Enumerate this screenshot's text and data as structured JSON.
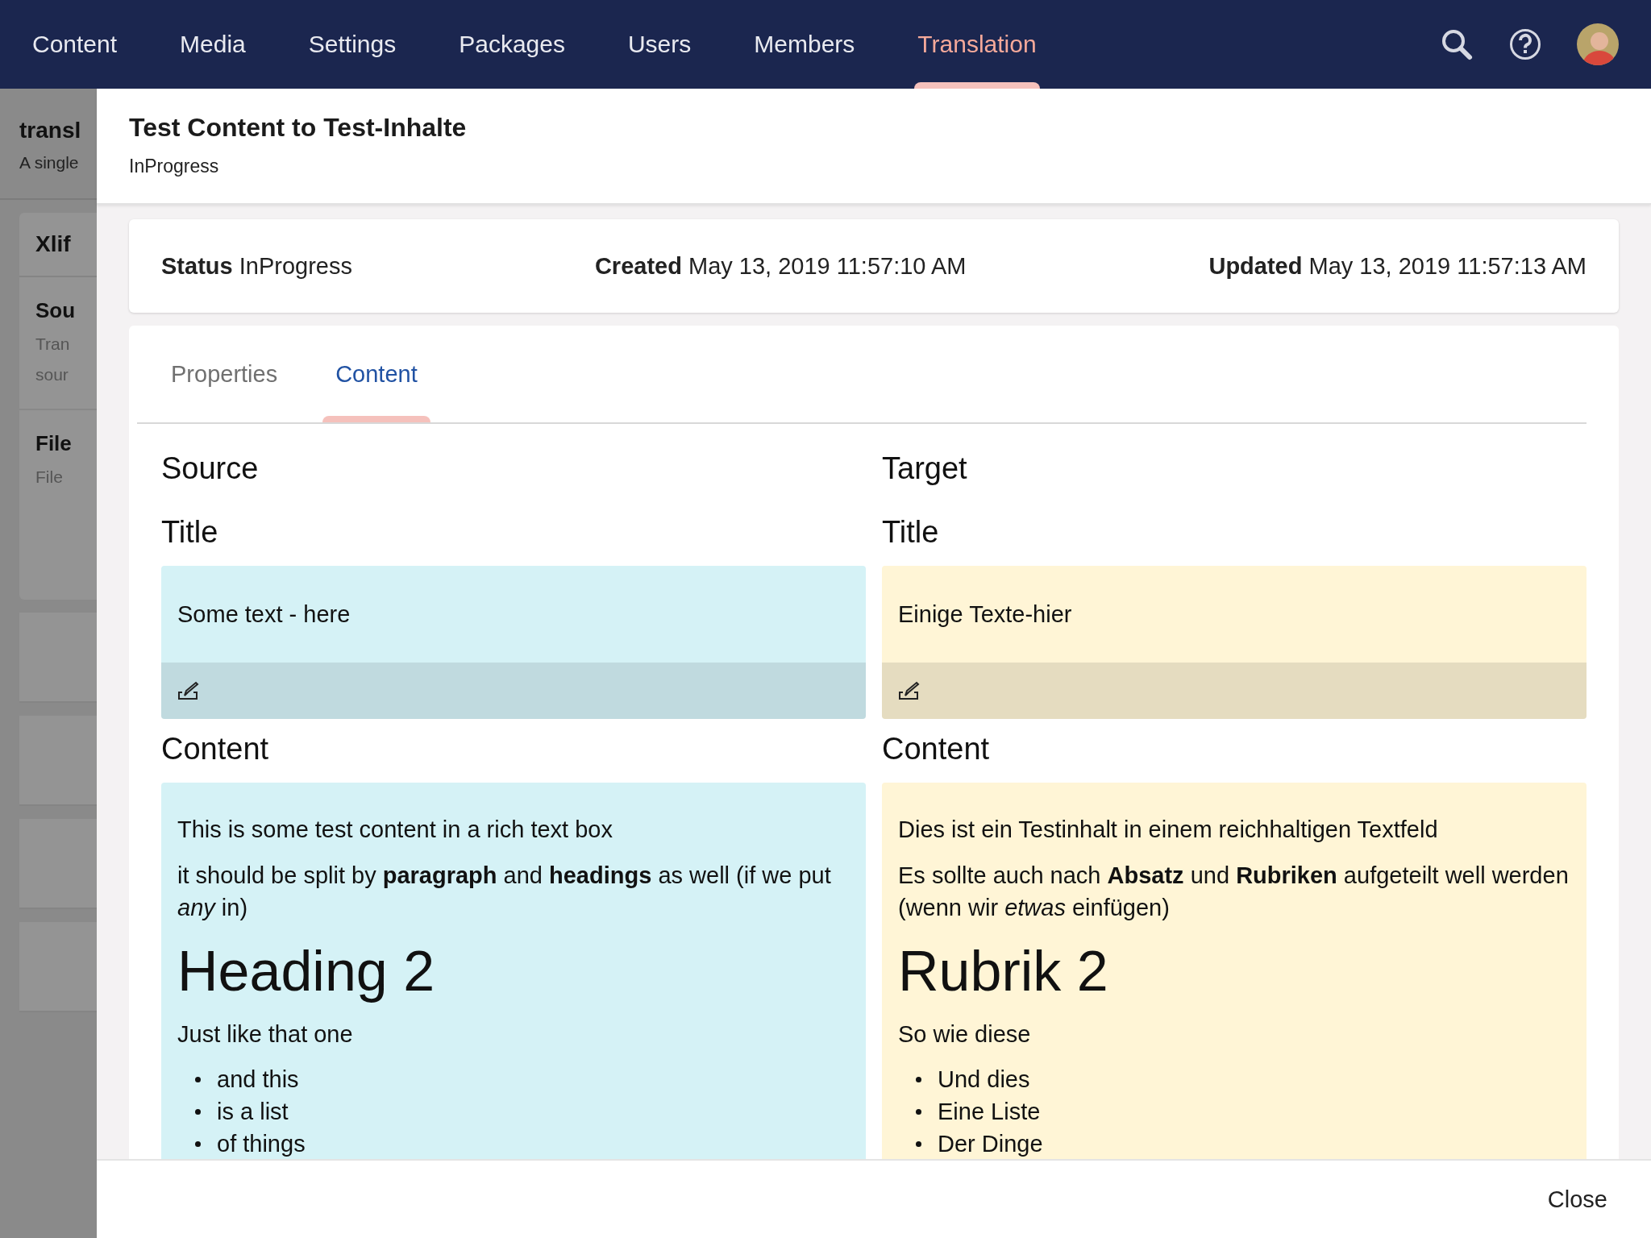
{
  "nav": {
    "items": [
      {
        "label": "Content",
        "selected": false
      },
      {
        "label": "Media",
        "selected": false
      },
      {
        "label": "Settings",
        "selected": false
      },
      {
        "label": "Packages",
        "selected": false
      },
      {
        "label": "Users",
        "selected": false
      },
      {
        "label": "Members",
        "selected": false
      },
      {
        "label": "Translation",
        "selected": true
      }
    ]
  },
  "background_page": {
    "title": "transl",
    "subtitle": "A single",
    "card_heading": "Xlif",
    "sections": [
      {
        "heading": "Sou",
        "lines": [
          "Tran",
          "sour"
        ]
      },
      {
        "heading": "File",
        "lines": [
          "File"
        ]
      }
    ]
  },
  "dialog": {
    "title": "Test Content to Test-Inhalte",
    "subtitle": "InProgress",
    "info": [
      {
        "label": "Status",
        "value": "InProgress"
      },
      {
        "label": "Created",
        "value": "May 13, 2019 11:57:10 AM"
      },
      {
        "label": "Updated",
        "value": "May 13, 2019 11:57:13 AM"
      }
    ],
    "tabs": [
      {
        "label": "Properties",
        "selected": false
      },
      {
        "label": "Content",
        "selected": true
      }
    ],
    "columns": [
      {
        "kind": "source",
        "heading": "Source",
        "fields": [
          {
            "label": "Title",
            "kind": "plain",
            "text": "Some text - here"
          },
          {
            "label": "Content",
            "kind": "rich",
            "blocks": [
              {
                "kind": "paragraph",
                "text": "This is some test content in a rich text box"
              },
              {
                "kind": "paragraph",
                "text": "it should be split by **paragraph** and **headings**  as well (if we put *any* in)"
              },
              {
                "kind": "heading",
                "text": "Heading 2"
              },
              {
                "kind": "paragraph",
                "text": "Just like that one"
              },
              {
                "kind": "list",
                "items": [
                  "and this",
                  "is a list",
                  "of things"
                ]
              }
            ]
          }
        ]
      },
      {
        "kind": "target",
        "heading": "Target",
        "fields": [
          {
            "label": "Title",
            "kind": "plain",
            "text": "Einige Texte-hier"
          },
          {
            "label": "Content",
            "kind": "rich",
            "blocks": [
              {
                "kind": "paragraph",
                "text": "Dies ist ein Testinhalt in einem reichhaltigen Textfeld"
              },
              {
                "kind": "paragraph",
                "text": "Es sollte auch nach **Absatz** und **Rubriken** aufgeteilt well werden (wenn wir *etwas* einfügen)"
              },
              {
                "kind": "heading",
                "text": "Rubrik 2"
              },
              {
                "kind": "paragraph",
                "text": "So wie diese"
              },
              {
                "kind": "list",
                "items": [
                  "Und dies",
                  "Eine Liste",
                  "Der Dinge"
                ]
              }
            ]
          }
        ]
      }
    ],
    "close_button": "Close"
  }
}
